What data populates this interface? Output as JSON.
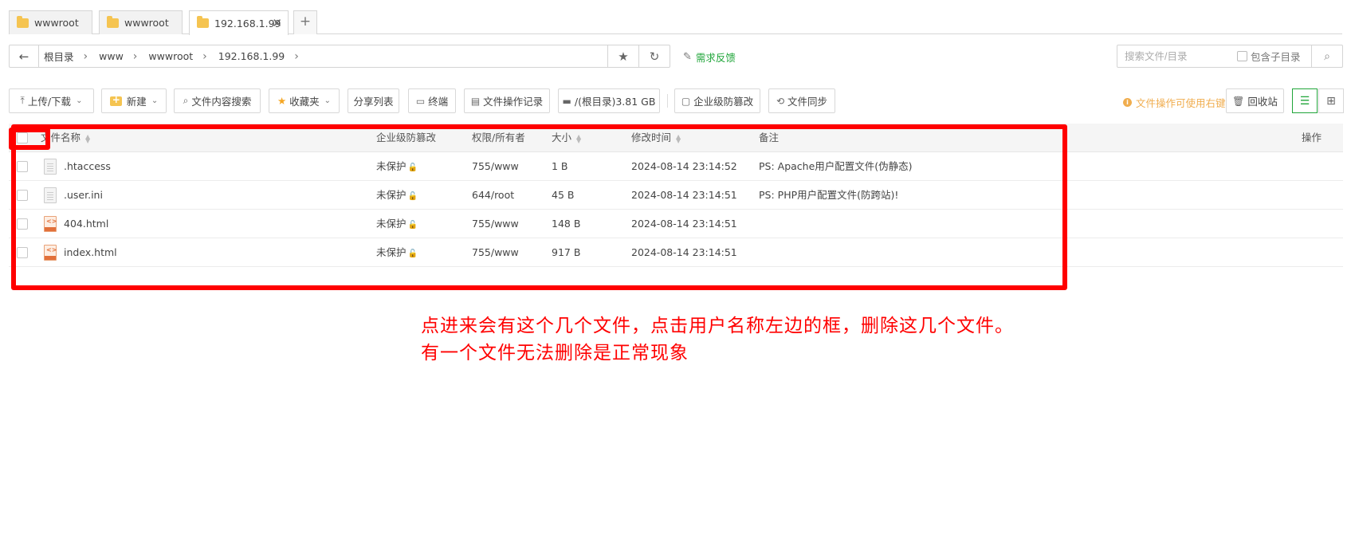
{
  "tabs": [
    {
      "label": "wwwroot",
      "active": false
    },
    {
      "label": "wwwroot",
      "active": false
    },
    {
      "label": "192.168.1.99",
      "active": true
    }
  ],
  "breadcrumb": [
    "根目录",
    "www",
    "wwwroot",
    "192.168.1.99"
  ],
  "feedback_label": "需求反馈",
  "search": {
    "placeholder": "搜索文件/目录",
    "include_sub_label": "包含子目录"
  },
  "toolbar": {
    "upload": "上传/下载",
    "new": "新建",
    "content_search": "文件内容搜索",
    "favorites": "收藏夹",
    "share_list": "分享列表",
    "terminal": "终端",
    "op_log": "文件操作记录",
    "disk": "/(根目录)3.81 GB",
    "tamper": "企业级防篡改",
    "sync": "文件同步",
    "tip": "文件操作可使用右键",
    "recycle": "回收站"
  },
  "table": {
    "headers": {
      "name": "文件名称",
      "tamper": "企业级防篡改",
      "perm": "权限/所有者",
      "size": "大小",
      "mtime": "修改时间",
      "note": "备注",
      "ops": "操作"
    },
    "rows": [
      {
        "name": ".htaccess",
        "type": "text",
        "tamper": "未保护",
        "perm": "755/www",
        "size": "1 B",
        "mtime": "2024-08-14 23:14:52",
        "note": "PS: Apache用户配置文件(伪静态)"
      },
      {
        "name": ".user.ini",
        "type": "text",
        "tamper": "未保护",
        "perm": "644/root",
        "size": "45 B",
        "mtime": "2024-08-14 23:14:51",
        "note": "PS: PHP用户配置文件(防跨站)!"
      },
      {
        "name": "404.html",
        "type": "html",
        "tamper": "未保护",
        "perm": "755/www",
        "size": "148 B",
        "mtime": "2024-08-14 23:14:51",
        "note": ""
      },
      {
        "name": "index.html",
        "type": "html",
        "tamper": "未保护",
        "perm": "755/www",
        "size": "917 B",
        "mtime": "2024-08-14 23:14:51",
        "note": ""
      }
    ]
  },
  "annotation": {
    "line1": "点进来会有这个几个文件，点击用户名称左边的框，删除这几个文件。",
    "line2": "有一个文件无法删除是正常现象",
    "color": "#ff0000"
  },
  "colors": {
    "accent": "#20a53a",
    "tip": "#f0ad4e",
    "folder": "#f5c451"
  }
}
